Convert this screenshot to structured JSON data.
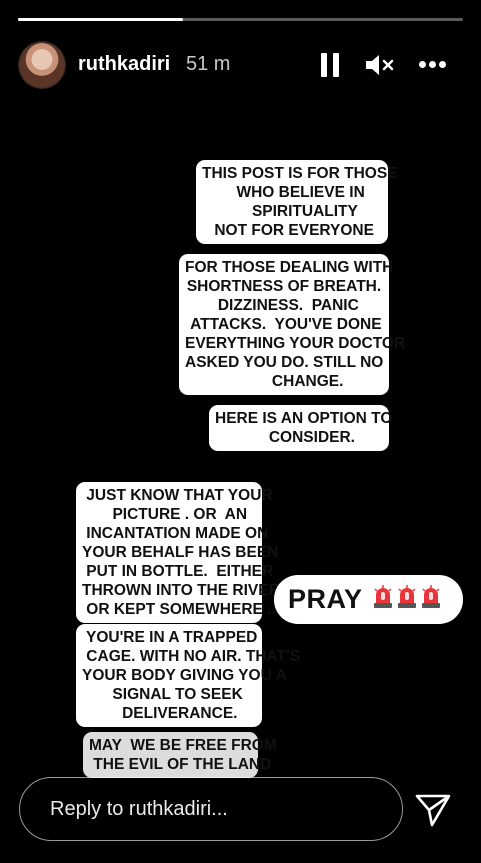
{
  "story": {
    "progress_fraction": 0.37
  },
  "header": {
    "username": "ruthkadiri",
    "time_ago": "51 m",
    "avatar_icon": "profile-avatar",
    "pause_icon": "pause-icon",
    "mute_icon": "speaker-muted-icon",
    "more_icon": "more-horizontal-icon"
  },
  "text_blocks": [
    "THIS POST IS FOR THOSE\n    WHO BELIEVE IN\n      SPIRITUALITY\n NOT FOR EVERYONE",
    "FOR THOSE DEALING WITH\nSHORTNESS OF BREATH.\n  DIZZINESS.  PANIC\n ATTACKS.  YOU'VE DONE\nEVERYTHING YOUR DOCTOR\nASKED YOU DO. STILL NO\n           CHANGE.",
    "HERE IS AN OPTION TO\n      CONSIDER.",
    " JUST KNOW THAT YOUR\n     PICTURE . OR  AN\n INCANTATION MADE ON\nYOUR BEHALF HAS BEEN\n PUT IN BOTTLE.  EITHER\nTHROWN INTO THE RIVER\n OR KEPT SOMEWHERE .",
    " YOU'RE IN A TRAPPED\n CAGE. WITH NO AIR. THAT'S\nYOUR BODY GIVING YOU A\n    SIGNAL TO SEEK\n     DELIVERANCE.",
    "MAY  WE BE FREE FROM\n THE EVIL OF THE LAND"
  ],
  "pray_sticker": {
    "label": "PRAY",
    "emoji_icon": "police-car-light-icon",
    "emoji_count": 3,
    "emoji_color": "#e8343a"
  },
  "reply": {
    "placeholder": "Reply to ruthkadiri...",
    "send_icon": "send-paper-plane-icon"
  },
  "colors": {
    "background": "#000000",
    "bubble": "#ffffff",
    "bubble_dim": "#dcdcdc"
  }
}
